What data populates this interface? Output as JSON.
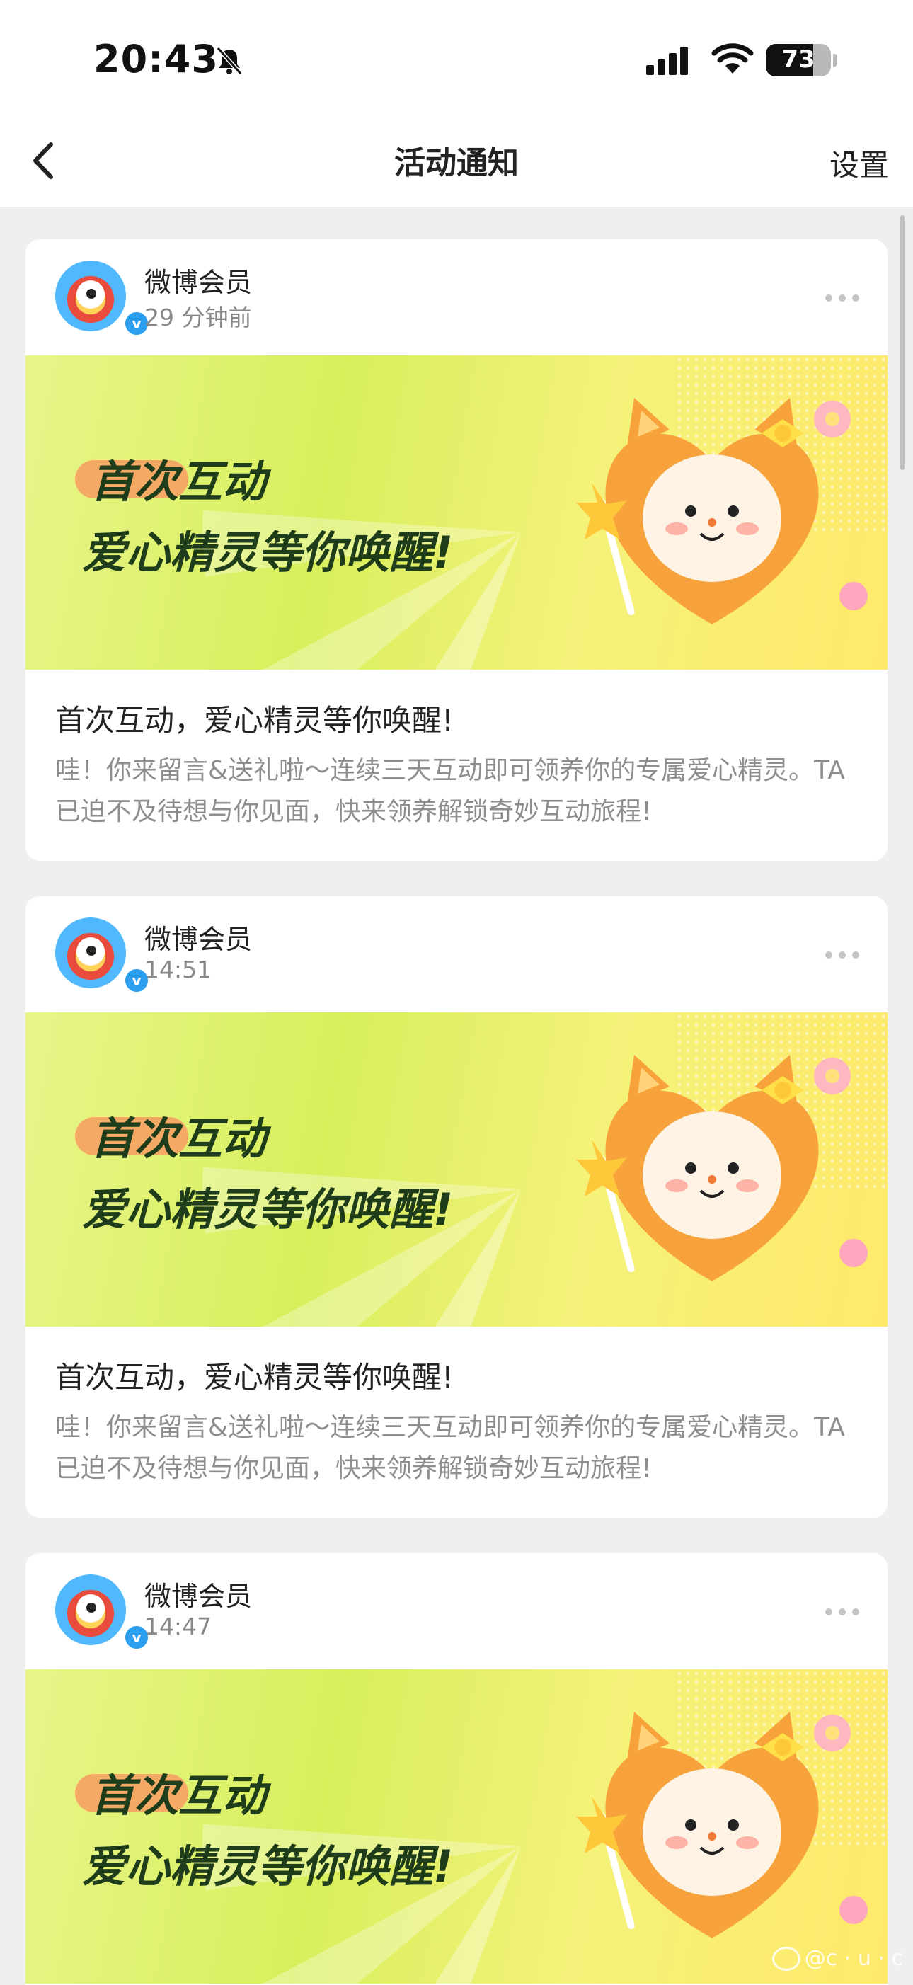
{
  "status": {
    "time": "20:43",
    "battery": "73",
    "battery_level": 0.73
  },
  "nav": {
    "title": "活动通知",
    "settings": "设置"
  },
  "banner": {
    "line1": "首次互动",
    "line2": "爱心精灵等你唤醒!"
  },
  "cards": [
    {
      "sender": "微博会员",
      "time": "29 分钟前",
      "title": "首次互动，爱心精灵等你唤醒!",
      "text": "哇！你来留言&送礼啦～连续三天互动即可领养你的专属爱心精灵。TA已迫不及待想与你见面，快来领养解锁奇妙互动旅程!"
    },
    {
      "sender": "微博会员",
      "time": "14:51",
      "title": "首次互动，爱心精灵等你唤醒!",
      "text": "哇！你来留言&送礼啦～连续三天互动即可领养你的专属爱心精灵。TA已迫不及待想与你见面，快来领养解锁奇妙互动旅程!"
    },
    {
      "sender": "微博会员",
      "time": "14:47"
    }
  ],
  "watermark": "@c · u · c",
  "colors": {
    "accent": "#2b9ff0",
    "banner_text": "#1f3d1a",
    "page_bg": "#efefef"
  }
}
